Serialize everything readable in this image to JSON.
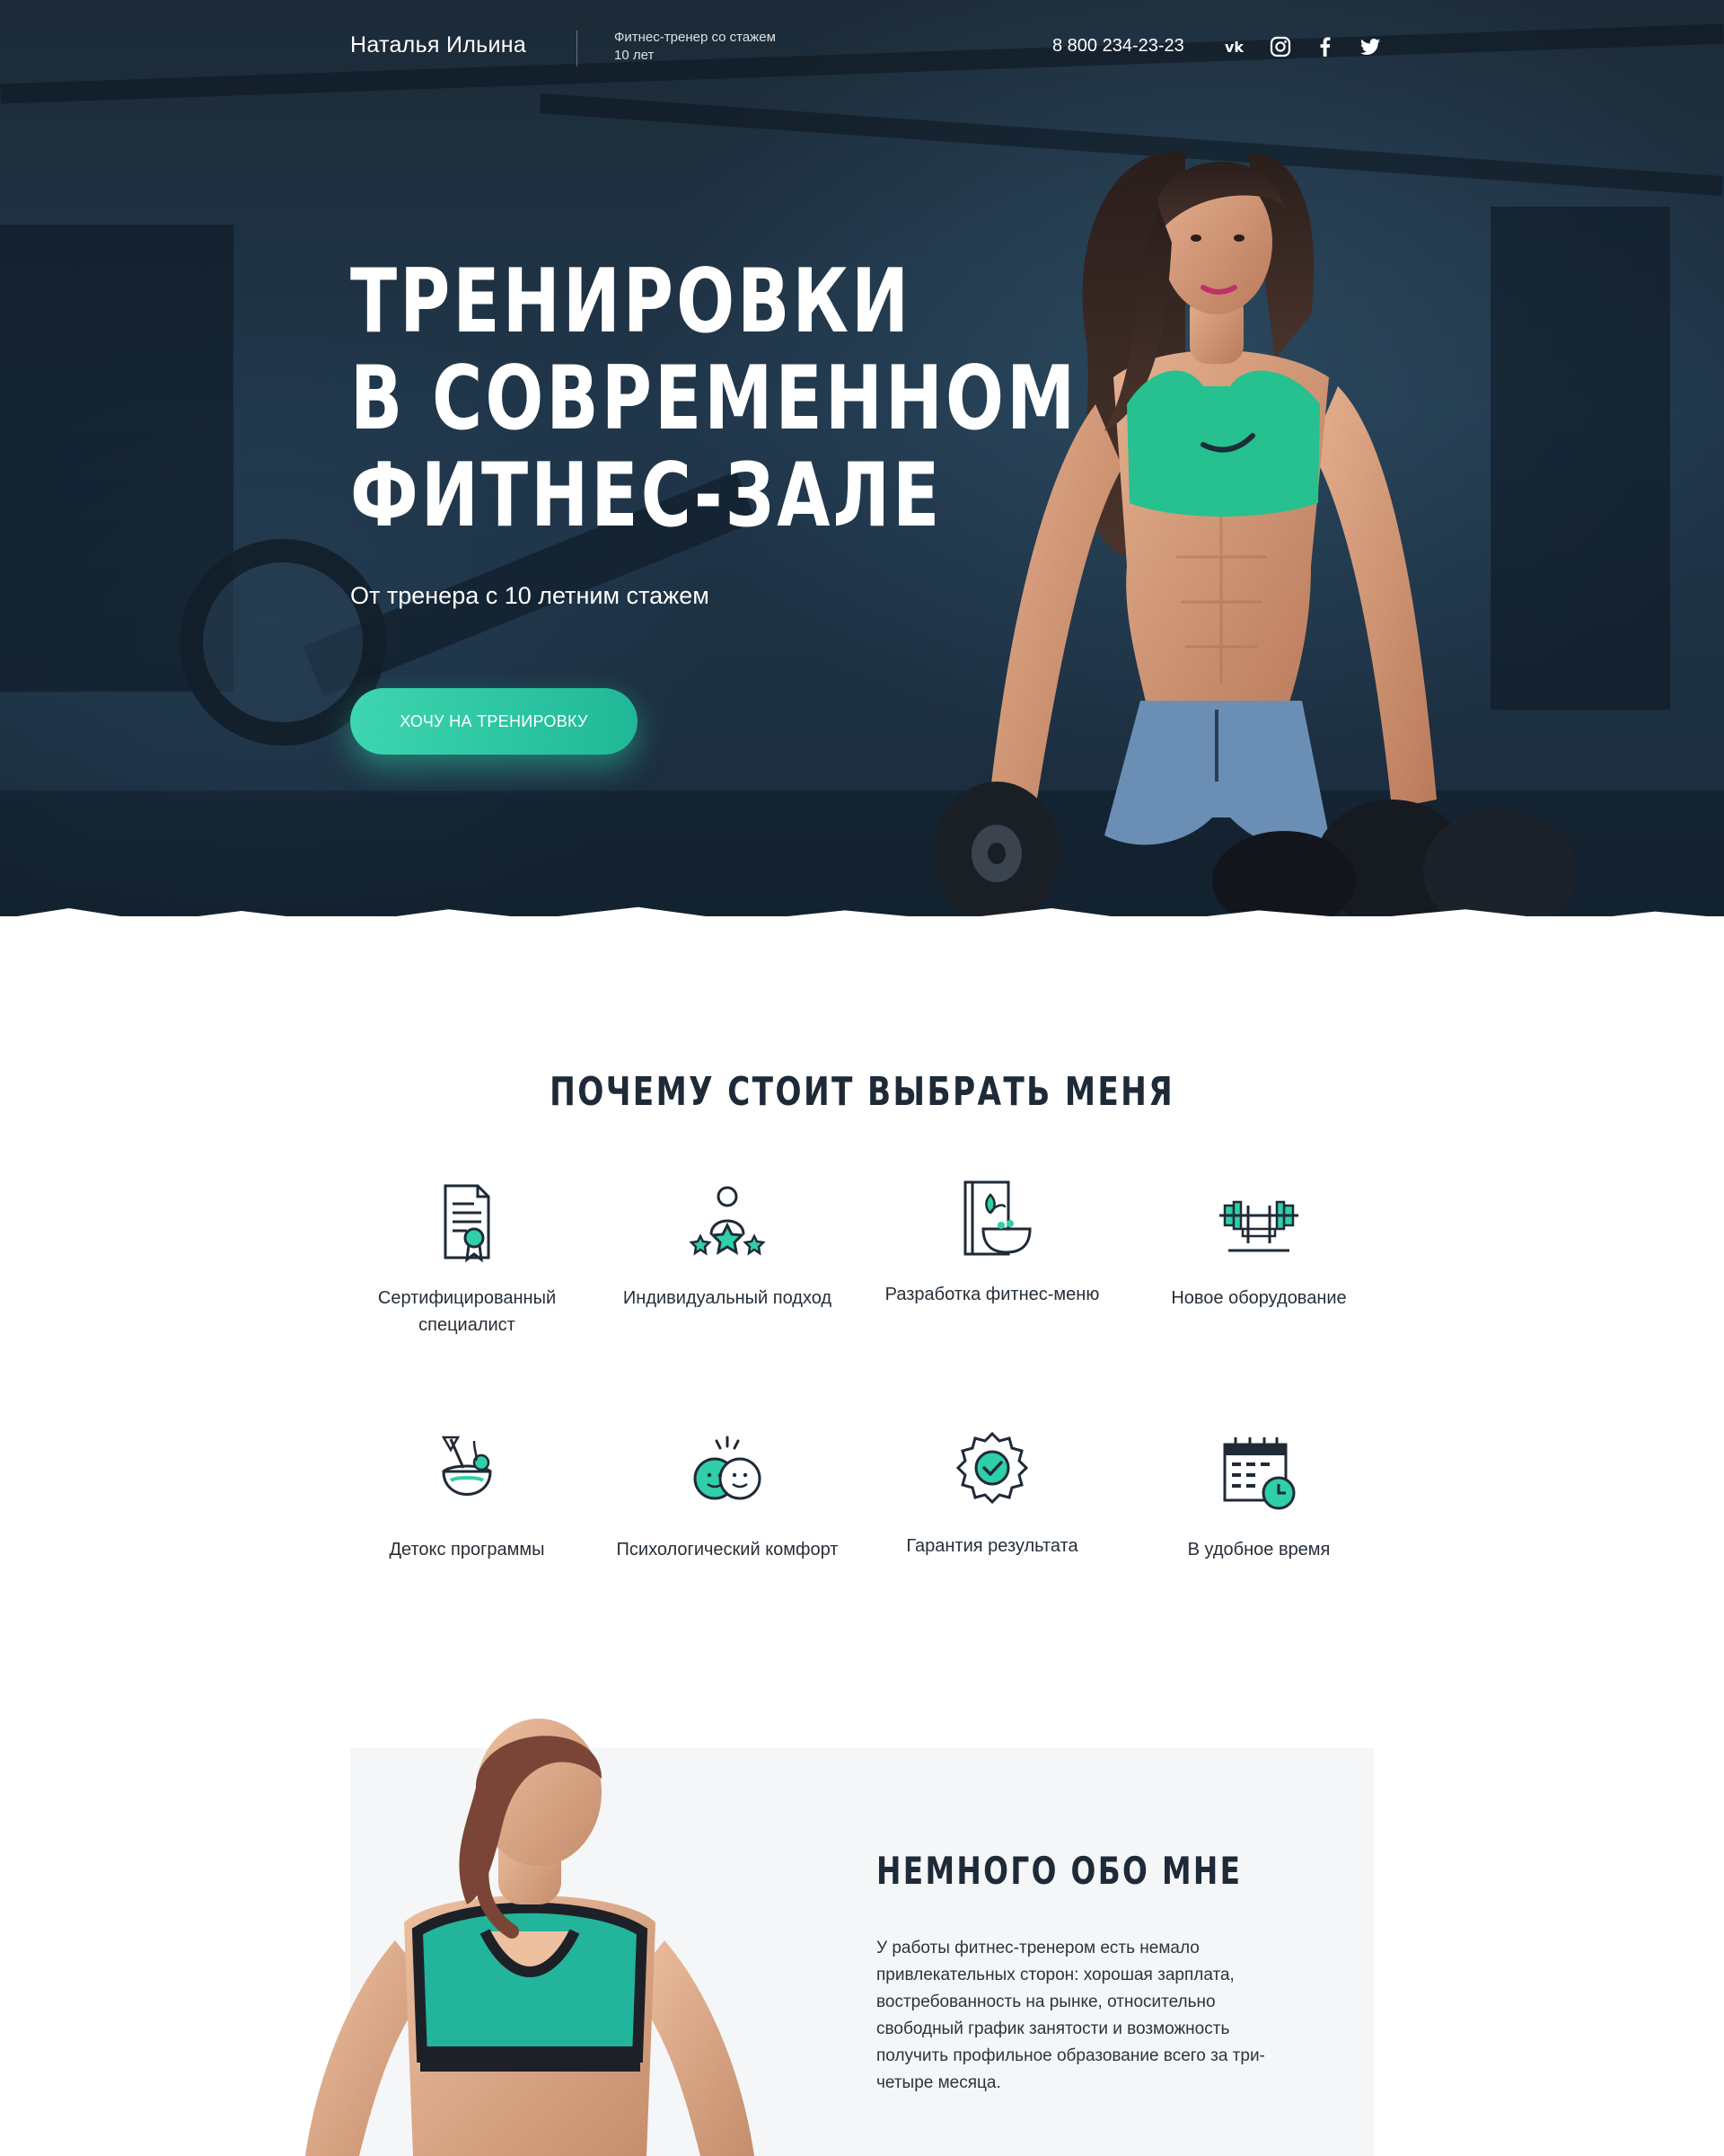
{
  "header": {
    "name": "Наталья Ильина",
    "subtitle": "Фитнес-тренер со стажем 10 лет",
    "phone": "8 800 234-23-23",
    "socials": [
      {
        "name": "vk-icon"
      },
      {
        "name": "instagram-icon"
      },
      {
        "name": "facebook-icon"
      },
      {
        "name": "twitter-icon"
      }
    ]
  },
  "hero": {
    "title_lines": [
      "ТРЕНИРОВКИ",
      "В СОВРЕМЕННОМ",
      "ФИТНЕС-ЗАЛЕ"
    ],
    "subtitle": "От тренера с 10 летним стажем",
    "cta": "ХОЧУ НА ТРЕНИРОВКУ"
  },
  "why": {
    "title": "ПОЧЕМУ СТОИТ ВЫБРАТЬ МЕНЯ",
    "features": [
      {
        "label": "Сертифицированный специалист",
        "icon": "certificate-icon"
      },
      {
        "label": "Индивидуальный подход",
        "icon": "trainer-stars-icon"
      },
      {
        "label": "Разработка фитнес-меню",
        "icon": "meal-plan-icon"
      },
      {
        "label": "Новое оборудование",
        "icon": "barbell-rack-icon"
      },
      {
        "label": "Детокс программы",
        "icon": "coconut-drink-icon"
      },
      {
        "label": "Психологический комфорт",
        "icon": "smiley-faces-icon"
      },
      {
        "label": "Гарантия результата",
        "icon": "guarantee-badge-icon"
      },
      {
        "label": "В удобное время",
        "icon": "calendar-clock-icon"
      }
    ]
  },
  "about": {
    "title": "НЕМНОГО ОБО МНЕ",
    "text": "У работы фитнес-тренером есть немало привлекательных сторон: хорошая зарплата, востребованность на рынке, относительно свободный график занятости и возможность получить профильное образование всего за три-четыре месяца."
  },
  "colors": {
    "accent": "#2fcfa9",
    "hero_bg": "#1e3142",
    "heading": "#1e2a38"
  }
}
